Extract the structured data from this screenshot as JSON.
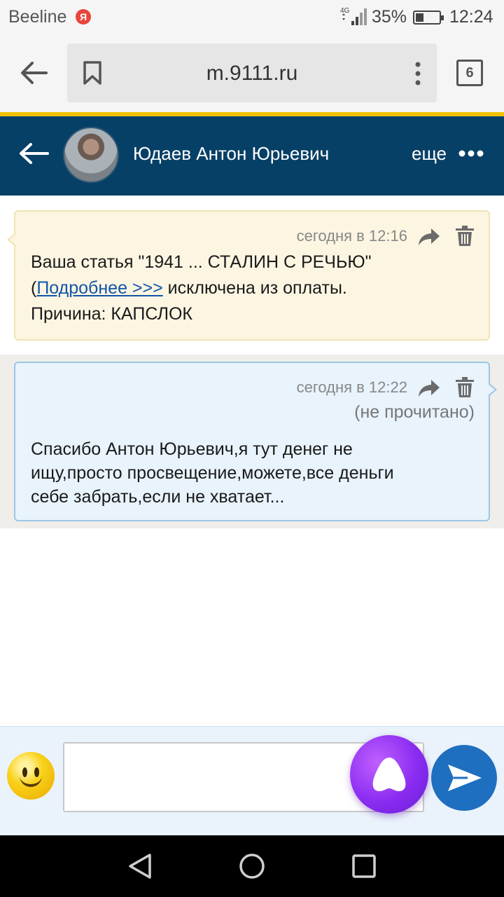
{
  "status_bar": {
    "carrier": "Beeline",
    "yandex_icon_letter": "Я",
    "network": "4G",
    "battery_percent": "35%",
    "battery_level": 0.35,
    "time": "12:24"
  },
  "browser": {
    "url": "m.9111.ru",
    "tabs_count": "6"
  },
  "chat_header": {
    "contact_name": "Юдаев Антон Юрьевич",
    "more_label": "еще"
  },
  "messages": [
    {
      "direction": "incoming",
      "time": "сегодня в 12:16",
      "line1": "Ваша статья \"1941 ... СТАЛИН С РЕЧЬЮ\"",
      "line2_prefix": "(",
      "link_text": "Подробнее >>>",
      "line2_suffix": " исключена из оплаты.",
      "line3": "Причина: КАПСЛОК"
    },
    {
      "direction": "outgoing",
      "time": "сегодня в 12:22",
      "status": "(не прочитано)",
      "text_line1": "Спасибо Антон Юрьевич,я тут денег  не",
      "text_line2": "ищу,просто просвещение,можете,все деньги",
      "text_line3": "себе забрать,если не хватает..."
    }
  ],
  "composer": {
    "input_value": "",
    "input_placeholder": ""
  },
  "colors": {
    "header_bg": "#074066",
    "accent_yellow": "#f2c200",
    "incoming_bubble": "#fbf5e2",
    "outgoing_bubble": "#e8f3fc",
    "send_button": "#1f6fc0",
    "alice_button": "#8a2cf0"
  },
  "icons": {
    "browser_back": "arrow-left-icon",
    "bookmark": "bookmark-icon",
    "browser_menu": "more-vertical-icon",
    "chat_back": "arrow-left-icon",
    "more": "more-horizontal-icon",
    "forward": "forward-icon",
    "delete": "trash-icon",
    "emoji": "smiley-icon",
    "assistant": "alice-icon",
    "send": "send-icon",
    "nav_back": "triangle-back-icon",
    "nav_home": "circle-home-icon",
    "nav_recent": "square-recent-icon"
  }
}
